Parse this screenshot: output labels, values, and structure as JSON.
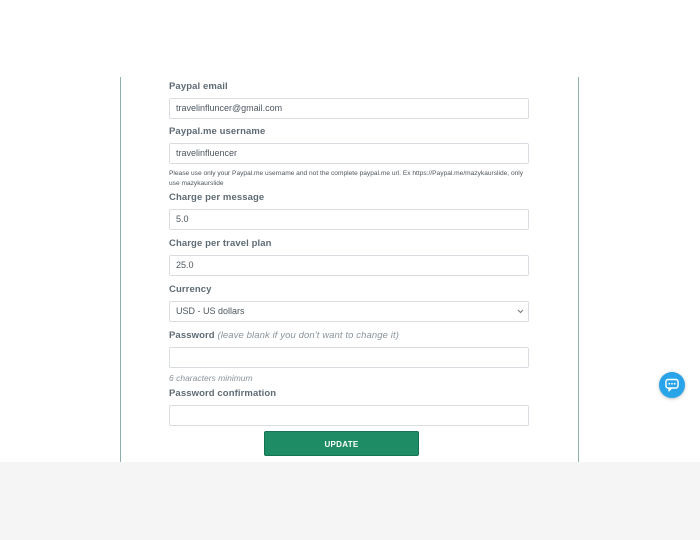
{
  "form": {
    "paypal_email": {
      "label": "Paypal email",
      "value": "travelinfluncer@gmail.com"
    },
    "paypal_me": {
      "label": "Paypal.me username",
      "value": "travelinfluencer",
      "help": "Please use only your Paypal.me username and not the complete paypal.me url. Ex https://Paypal.me/mazykaurslide, only use mazykaurslide"
    },
    "charge_message": {
      "label": "Charge per message",
      "value": "5.0"
    },
    "charge_plan": {
      "label": "Charge per travel plan",
      "value": "25.0"
    },
    "currency": {
      "label": "Currency",
      "value": "USD - US dollars"
    },
    "password": {
      "label": "Password",
      "hint": "(leave blank if you don't want to change it)",
      "value": "",
      "help": "6 characters minimum"
    },
    "password_confirmation": {
      "label": "Password confirmation",
      "value": ""
    },
    "submit_label": "UPDATE"
  },
  "colors": {
    "accent": "#1e8c65",
    "chat": "#2aa4e8"
  },
  "icons": {
    "chat": "chat-bubble-icon",
    "select": "chevron-down-icon"
  }
}
